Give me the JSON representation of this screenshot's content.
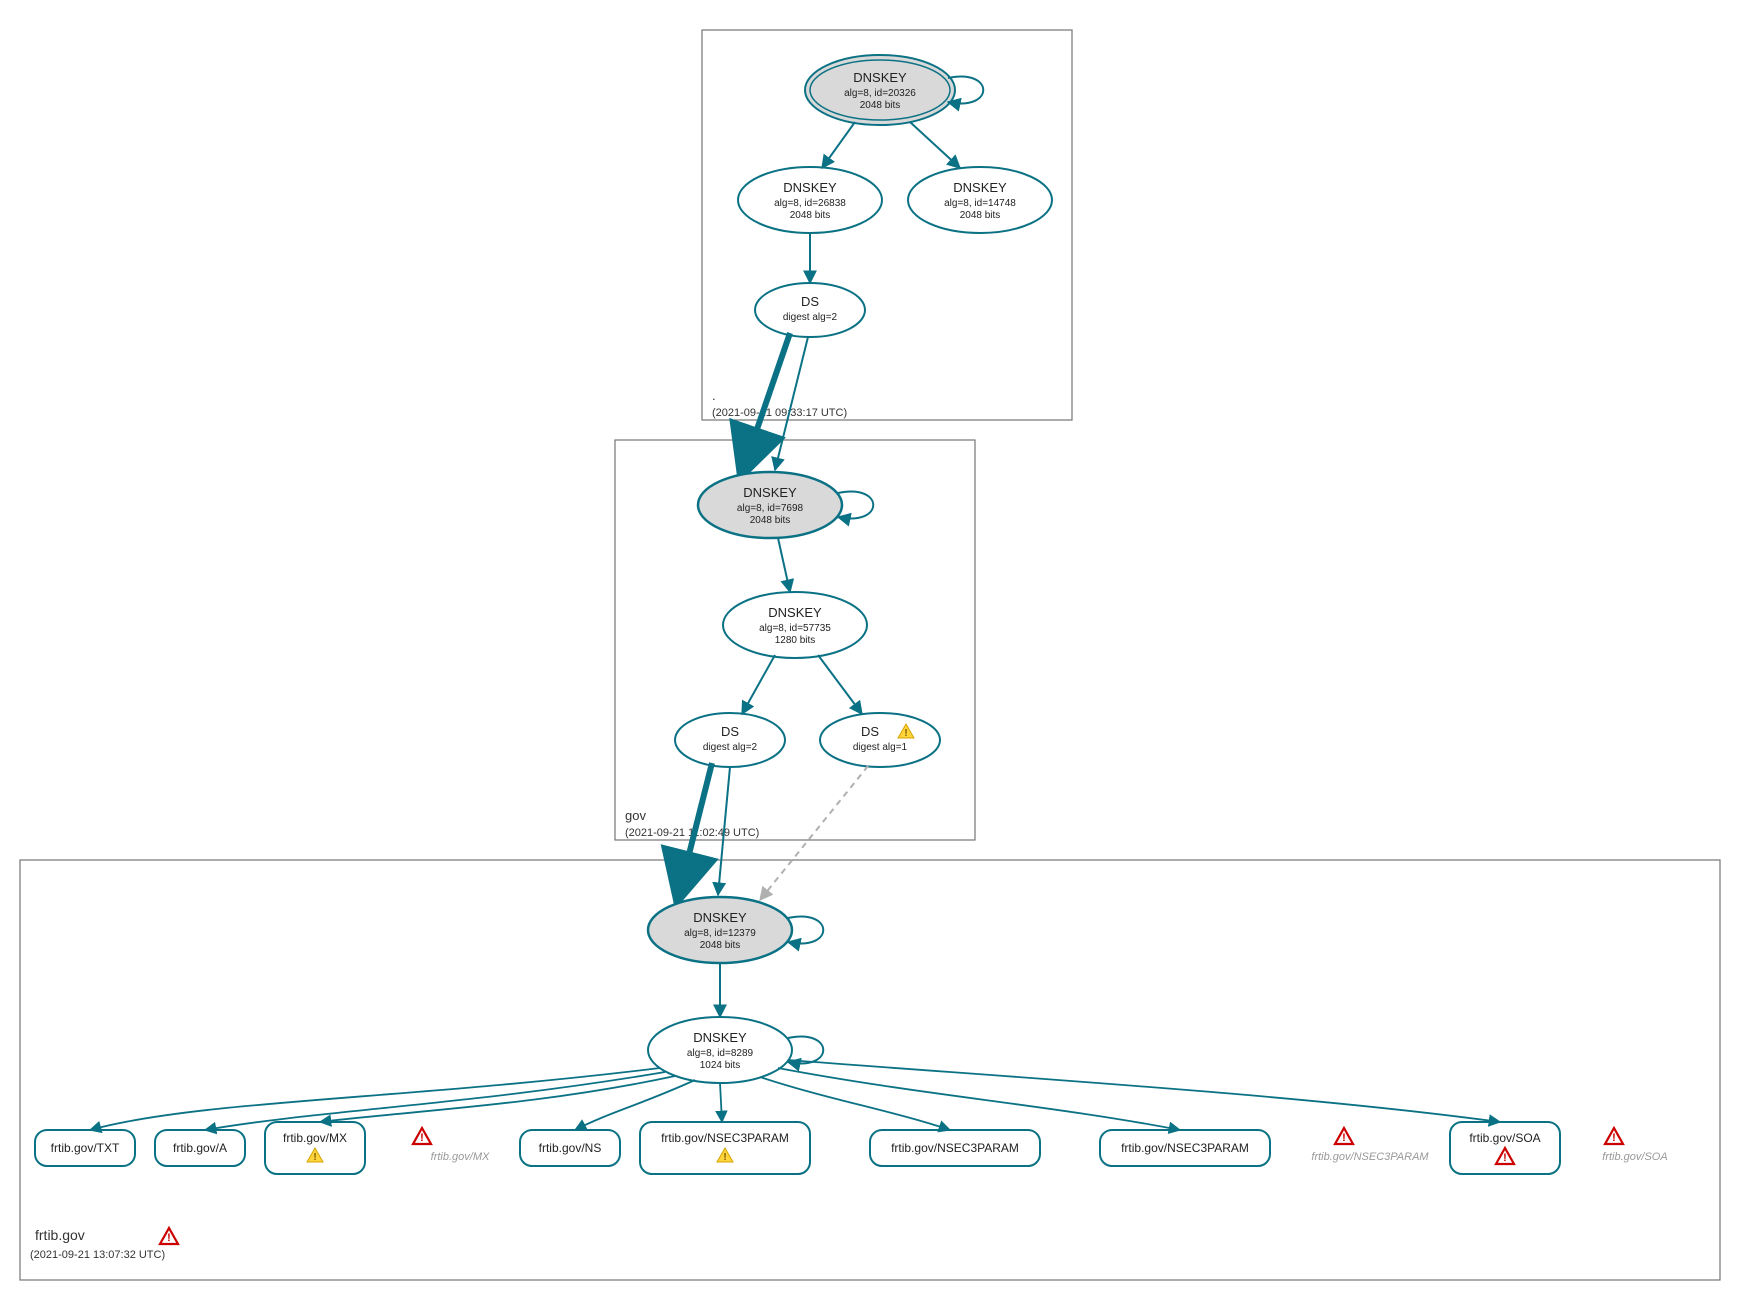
{
  "zones": {
    "root": {
      "label": ".",
      "timestamp": "(2021-09-21 09:33:17 UTC)"
    },
    "gov": {
      "label": "gov",
      "timestamp": "(2021-09-21 11:02:49 UTC)"
    },
    "frtib": {
      "label": "frtib.gov",
      "timestamp": "(2021-09-21 13:07:32 UTC)"
    }
  },
  "nodes": {
    "root_ksk": {
      "title": "DNSKEY",
      "line1": "alg=8, id=20326",
      "line2": "2048 bits"
    },
    "root_zsk1": {
      "title": "DNSKEY",
      "line1": "alg=8, id=26838",
      "line2": "2048 bits"
    },
    "root_zsk2": {
      "title": "DNSKEY",
      "line1": "alg=8, id=14748",
      "line2": "2048 bits"
    },
    "root_ds": {
      "title": "DS",
      "line1": "digest alg=2",
      "line2": ""
    },
    "gov_ksk": {
      "title": "DNSKEY",
      "line1": "alg=8, id=7698",
      "line2": "2048 bits"
    },
    "gov_zsk": {
      "title": "DNSKEY",
      "line1": "alg=8, id=57735",
      "line2": "1280 bits"
    },
    "gov_ds1": {
      "title": "DS",
      "line1": "digest alg=2",
      "line2": ""
    },
    "gov_ds2": {
      "title": "DS",
      "line1": "digest alg=1",
      "line2": ""
    },
    "frtib_ksk": {
      "title": "DNSKEY",
      "line1": "alg=8, id=12379",
      "line2": "2048 bits"
    },
    "frtib_zsk": {
      "title": "DNSKEY",
      "line1": "alg=8, id=8289",
      "line2": "1024 bits"
    }
  },
  "leaves": {
    "txt": "frtib.gov/TXT",
    "a": "frtib.gov/A",
    "mx": "frtib.gov/MX",
    "mx_nx": "frtib.gov/MX",
    "ns": "frtib.gov/NS",
    "n3p1": "frtib.gov/NSEC3PARAM",
    "n3p2": "frtib.gov/NSEC3PARAM",
    "n3p3": "frtib.gov/NSEC3PARAM",
    "n3p_nx": "frtib.gov/NSEC3PARAM",
    "soa": "frtib.gov/SOA",
    "soa_nx": "frtib.gov/SOA"
  },
  "colors": {
    "teal": "#0b7285",
    "gray_fill": "#d9d9d9",
    "box": "#757575",
    "muted": "#999999"
  }
}
